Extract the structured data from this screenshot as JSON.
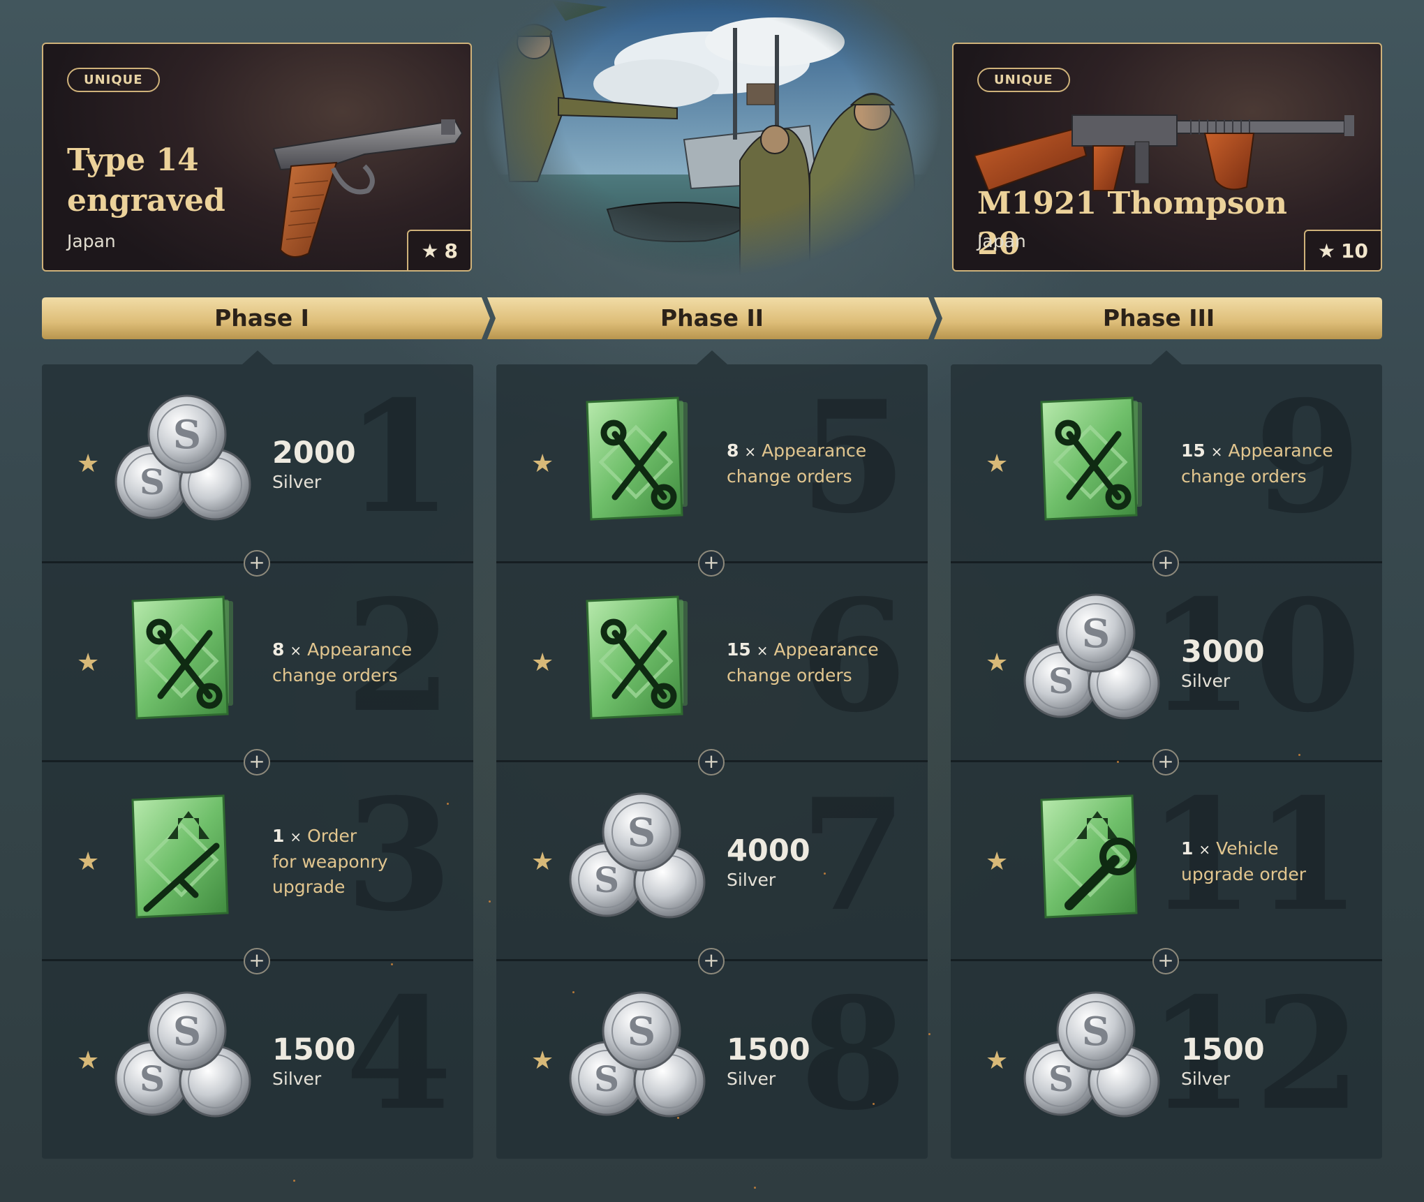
{
  "rewards_top": {
    "left": {
      "badge": "UNIQUE",
      "name": "Type 14 engraved",
      "nation": "Japan",
      "rating": "8",
      "icon": "pistol-icon"
    },
    "right": {
      "badge": "UNIQUE",
      "name": "M1921 Thompson 20",
      "nation": "Japan",
      "rating": "10",
      "icon": "submachine-gun-icon"
    }
  },
  "colors": {
    "gold": "#cfb27a",
    "phase_bar": "#e3c88a",
    "panel": "#232f35",
    "order_green": "#6fbf6a",
    "order_text": "#e2c68f"
  },
  "phases": [
    {
      "label": "Phase I",
      "rows": [
        {
          "num": "1",
          "type": "silver",
          "amount": "2000",
          "unit": "Silver"
        },
        {
          "num": "2",
          "type": "appearance",
          "count": "8",
          "line1": "Appearance",
          "line2": "change orders"
        },
        {
          "num": "3",
          "type": "weapon-upgrade",
          "count": "1",
          "line1": "Order",
          "line2": "for weaponry",
          "line3": "upgrade"
        },
        {
          "num": "4",
          "type": "silver",
          "amount": "1500",
          "unit": "Silver"
        }
      ]
    },
    {
      "label": "Phase II",
      "rows": [
        {
          "num": "5",
          "type": "appearance",
          "count": "8",
          "line1": "Appearance",
          "line2": "change orders"
        },
        {
          "num": "6",
          "type": "appearance",
          "count": "15",
          "line1": "Appearance",
          "line2": "change orders"
        },
        {
          "num": "7",
          "type": "silver",
          "amount": "4000",
          "unit": "Silver"
        },
        {
          "num": "8",
          "type": "silver",
          "amount": "1500",
          "unit": "Silver"
        }
      ]
    },
    {
      "label": "Phase III",
      "rows": [
        {
          "num": "9",
          "type": "appearance",
          "count": "15",
          "line1": "Appearance",
          "line2": "change orders"
        },
        {
          "num": "10",
          "type": "silver",
          "amount": "3000",
          "unit": "Silver"
        },
        {
          "num": "11",
          "type": "vehicle-upgrade",
          "count": "1",
          "line1": "Vehicle",
          "line2": "upgrade order"
        },
        {
          "num": "12",
          "type": "silver",
          "amount": "1500",
          "unit": "Silver"
        }
      ]
    }
  ],
  "times_symbol": "×",
  "plus_symbol": "+",
  "star_symbol": "★"
}
